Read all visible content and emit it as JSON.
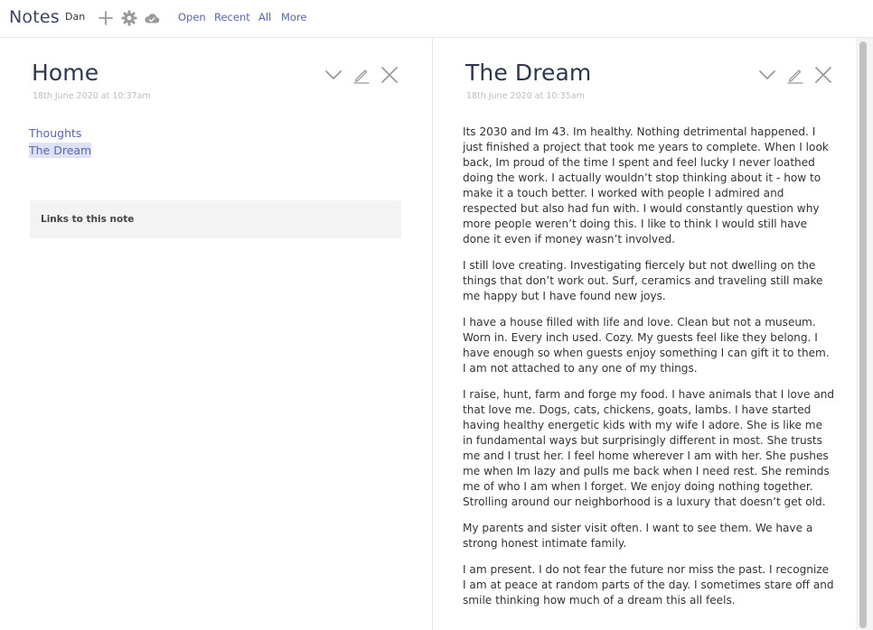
{
  "app": {
    "title": "Notes",
    "user": "Dan"
  },
  "toolbar": {
    "icons": [
      "plus-icon",
      "gear-icon",
      "cloud-icon"
    ],
    "links": [
      "Open",
      "Recent",
      "All",
      "More"
    ]
  },
  "left_note": {
    "title": "Home",
    "date": "18th June 2020 at 10:37am",
    "links": [
      "Thoughts",
      "The Dream"
    ],
    "backlinks_label": "Links to this note"
  },
  "right_note": {
    "title": "The Dream",
    "date": "18th June 2020 at 10:35am",
    "paragraphs": [
      "Its 2030 and Im 43. Im healthy. Nothing detrimental happened. I just finished a project that took me years to complete. When I look back, Im proud of the time I spent and feel lucky I never loathed doing the work. I actually wouldn’t stop thinking about it - how to make it a touch better. I worked with people I admired and respected but also had fun with. I would constantly question why more people weren’t doing this. I like to think I would still have done it even if money wasn’t involved.",
      "I still love creating. Investigating fiercely but not dwelling on the things that don’t work out. Surf, ceramics and traveling still make me happy but I have found new joys.",
      "I have a house filled with life and love. Clean but not a museum. Worn in. Every inch used. Cozy. My guests feel like they belong. I have enough so when guests enjoy something I can gift it to them. I am not attached to any one of my things.",
      "I raise, hunt, farm and forge my food. I have animals that I love and that love me. Dogs, cats, chickens, goats, lambs. I have started having healthy energetic kids with my wife I adore. She is like me in fundamental ways but surprisingly different in most. She trusts me and I trust her. I feel home wherever I am with her. She pushes me when Im lazy and pulls me back when I need rest. She reminds me of who I am when I forget. We enjoy doing nothing together. Strolling around our neighborhood is a luxury that doesn’t get old.",
      "My parents and sister visit often. I want to see them. We have a strong honest intimate family.",
      "I am present. I do not fear the future nor miss the past. I recognize I am at peace at random parts of the day. I sometimes stare off and smile thinking how much of a dream this all feels."
    ]
  },
  "colors": {
    "accent": "#5566b8",
    "title": "#2c3850",
    "muted": "#bdbdbd"
  }
}
